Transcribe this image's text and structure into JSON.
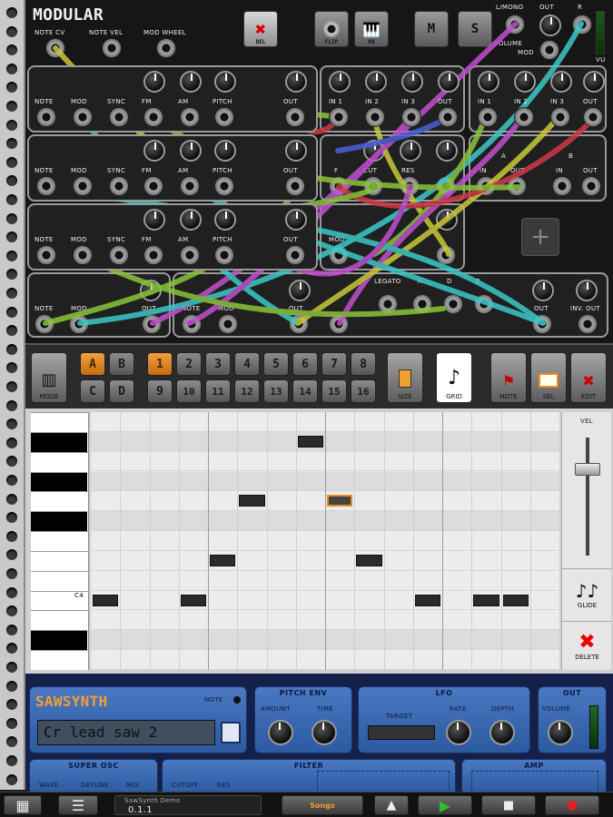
{
  "header": {
    "title": "MODULAR",
    "inputs": [
      "NOTE CV",
      "NOTE VEL",
      "MOD WHEEL"
    ],
    "buttons": {
      "del": "DEL",
      "flip": "FLIP",
      "kb": "KB",
      "m": "M",
      "s": "S"
    },
    "out_labels": {
      "mono": "L/MONO",
      "out": "OUT",
      "r": "R",
      "volume": "VOLUME",
      "mod": "MOD",
      "vu": "VU"
    }
  },
  "osc_labels": {
    "note": "NOTE",
    "mod": "MOD",
    "sync": "SYNC",
    "fm": "FM",
    "am": "AM",
    "pitch": "PITCH",
    "out": "OUT"
  },
  "mixer_labels": {
    "in1": "IN 1",
    "in2": "IN 2",
    "in3": "IN 3",
    "out": "OUT"
  },
  "filter_labels": {
    "f": "F",
    "cut": "CUT",
    "res": "RES",
    "out": "OUT"
  },
  "ab_labels": {
    "a": "A",
    "b": "B",
    "in": "IN",
    "out": "OUT"
  },
  "env_labels": {
    "a": "A",
    "d": "D",
    "r": "R",
    "out": "OUT",
    "inv_out": "INV. OUT"
  },
  "lower_labels": {
    "note": "NOTE",
    "mod": "MOD",
    "out": "OUT",
    "legato": "LEGATO"
  },
  "toolbar": {
    "mode": "MODE",
    "banks": [
      "A",
      "B",
      "C",
      "D"
    ],
    "patterns": [
      "1",
      "2",
      "3",
      "4",
      "5",
      "6",
      "7",
      "8",
      "9",
      "10",
      "11",
      "12",
      "13",
      "14",
      "15",
      "16"
    ],
    "size": "SIZE",
    "grid": "GRID",
    "note": "NOTE",
    "sel": "SEL",
    "edit": "EDIT"
  },
  "roll": {
    "c4_label": "C4",
    "vel": "VEL",
    "glide": "GLIDE",
    "delete": "DELETE",
    "notes": [
      {
        "col": 0,
        "row": 9
      },
      {
        "col": 3,
        "row": 9
      },
      {
        "col": 4,
        "row": 7
      },
      {
        "col": 5,
        "row": 4
      },
      {
        "col": 7,
        "row": 1
      },
      {
        "col": 8,
        "row": 4,
        "selected": true
      },
      {
        "col": 9,
        "row": 7
      },
      {
        "col": 11,
        "row": 9
      },
      {
        "col": 13,
        "row": 9
      },
      {
        "col": 14,
        "row": 9
      }
    ]
  },
  "synth": {
    "name": "SAWSYNTH",
    "note_label": "NOTE",
    "patch": "Cr lead saw 2",
    "pitch_env": {
      "title": "PITCH ENV",
      "amount": "AMOUNT",
      "time": "TIME"
    },
    "lfo": {
      "title": "LFO",
      "target": "TARGET",
      "rate": "RATE",
      "depth": "DEPTH"
    },
    "out": {
      "title": "OUT",
      "volume": "VOLUME"
    },
    "super_osc": {
      "title": "SUPER OSC",
      "wave": "WAVE",
      "detune": "DETUNE",
      "mix": "MIX"
    },
    "filter": {
      "title": "FILTER",
      "cutoff": "CUTOFF",
      "res": "RES"
    },
    "amp": {
      "title": "AMP"
    }
  },
  "transport": {
    "song_name": "SawSynth Demo",
    "position": "0.1.1",
    "songs": "Songs"
  },
  "colors": {
    "orange": "#f08a20",
    "blue_panel": "#3e6db8",
    "cable_green": "#8ac43a",
    "cable_teal": "#3cc8c8",
    "cable_purple": "#c050d0",
    "cable_yellow": "#c8c83a",
    "cable_red": "#d0384a",
    "cable_blue": "#4a60d8"
  }
}
